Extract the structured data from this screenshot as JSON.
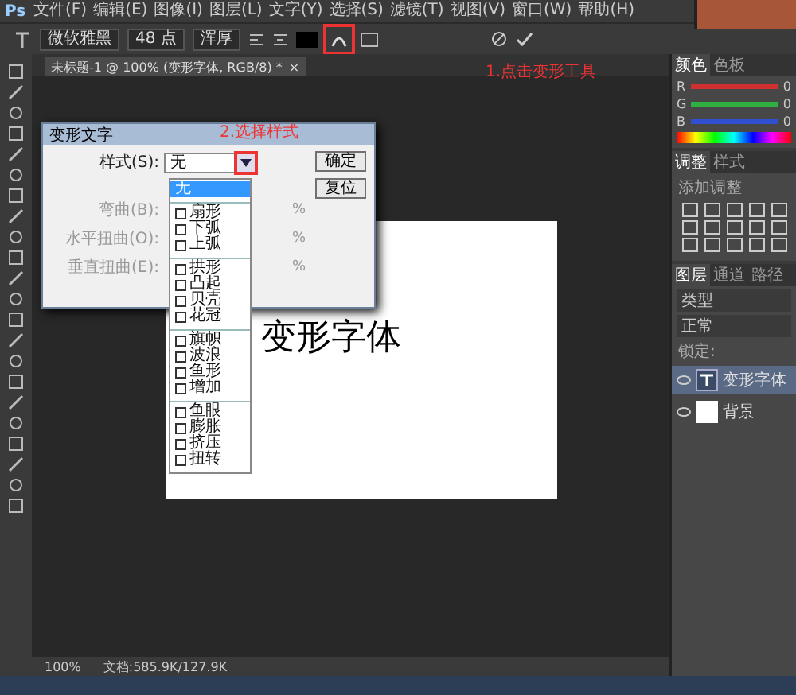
{
  "app_logo": "Ps",
  "menu": [
    "文件(F)",
    "编辑(E)",
    "图像(I)",
    "图层(L)",
    "文字(Y)",
    "选择(S)",
    "滤镜(T)",
    "视图(V)",
    "窗口(W)",
    "帮助(H)"
  ],
  "options_bar": {
    "font_family": "微软雅黑",
    "font_size": "48 点",
    "antialias": "浑厚",
    "warp_button": {
      "highlighted": true
    }
  },
  "document_tab": {
    "title": "未标题-1 @ 100% (变形字体, RGB/8) *",
    "close": "×"
  },
  "annotations": [
    {
      "text": "1.点击变形工具",
      "kind": "toolbar"
    },
    {
      "text": "2.选择样式",
      "kind": "dialog"
    }
  ],
  "canvas": {
    "text": "变形字体"
  },
  "dialog": {
    "title": "变形文字",
    "style_label": "样式(S):",
    "style_value": "无",
    "arrow_highlighted": true,
    "sliders": [
      {
        "label": "弯曲(B):",
        "unit": "%"
      },
      {
        "label": "水平扭曲(O):",
        "unit": "%"
      },
      {
        "label": "垂直扭曲(E):",
        "unit": "%"
      }
    ],
    "buttons": [
      "确定",
      "复位"
    ],
    "style_groups": [
      {
        "items": [
          {
            "label": "无",
            "selected": true
          }
        ]
      },
      {
        "items": [
          {
            "label": "扇形",
            "selected": false
          },
          {
            "label": "下弧",
            "selected": false
          },
          {
            "label": "上弧",
            "selected": false
          }
        ]
      },
      {
        "items": [
          {
            "label": "拱形",
            "selected": false
          },
          {
            "label": "凸起",
            "selected": false
          },
          {
            "label": "贝壳",
            "selected": false
          },
          {
            "label": "花冠",
            "selected": false
          }
        ]
      },
      {
        "items": [
          {
            "label": "旗帜",
            "selected": false
          },
          {
            "label": "波浪",
            "selected": false
          },
          {
            "label": "鱼形",
            "selected": false
          },
          {
            "label": "增加",
            "selected": false
          }
        ]
      },
      {
        "items": [
          {
            "label": "鱼眼",
            "selected": false
          },
          {
            "label": "膨胀",
            "selected": false
          },
          {
            "label": "挤压",
            "selected": false
          },
          {
            "label": "扭转",
            "selected": false
          }
        ]
      }
    ]
  },
  "color_panel": {
    "tabs": [
      {
        "label": "颜色",
        "selected": true
      },
      {
        "label": "色板",
        "selected": false
      }
    ],
    "channels": [
      {
        "name": "R",
        "value": "0",
        "color": "#d03030"
      },
      {
        "name": "G",
        "value": "0",
        "color": "#30b040"
      },
      {
        "name": "B",
        "value": "0",
        "color": "#3050d0"
      }
    ]
  },
  "adjust_panel": {
    "tabs": [
      {
        "label": "调整",
        "selected": true
      },
      {
        "label": "样式",
        "selected": false
      }
    ],
    "hint": "添加调整"
  },
  "layers_panel": {
    "tabs": [
      {
        "label": "图层",
        "selected": true
      },
      {
        "label": "通道",
        "selected": false
      },
      {
        "label": "路径",
        "selected": false
      }
    ],
    "filter": "类型",
    "blend": "正常",
    "lock": "锁定:",
    "layers": [
      {
        "name": "变形字体",
        "kind": "text",
        "selected": true
      },
      {
        "name": "背景",
        "kind": "image",
        "selected": false
      }
    ]
  },
  "status_bar": {
    "zoom": "100%",
    "doc": "文档:585.9K/127.9K"
  }
}
